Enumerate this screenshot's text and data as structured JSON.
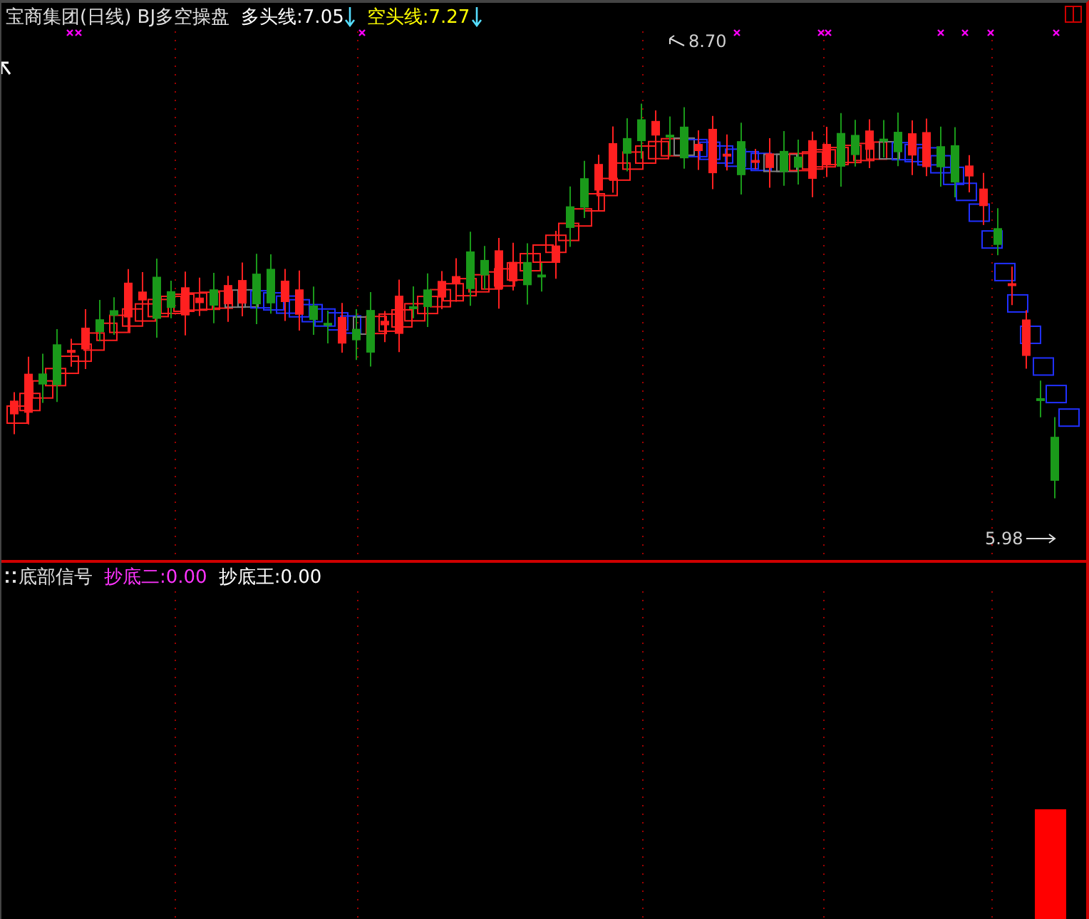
{
  "main_panel": {
    "title": "宝商集团(日线) BJ多空操盘",
    "indicators": [
      {
        "label": "多头线:7.05",
        "color": "#ffffff"
      },
      {
        "label": "空头线:7.27",
        "color": "#ffff00"
      }
    ],
    "high_label": "8.70",
    "low_label": "5.98"
  },
  "sub_panel": {
    "title": "底部信号",
    "indicators": [
      {
        "label": "抄底二:0.00",
        "color": "#ff33ff"
      },
      {
        "label": "抄底王:0.00",
        "color": "#ffffff"
      }
    ]
  }
}
